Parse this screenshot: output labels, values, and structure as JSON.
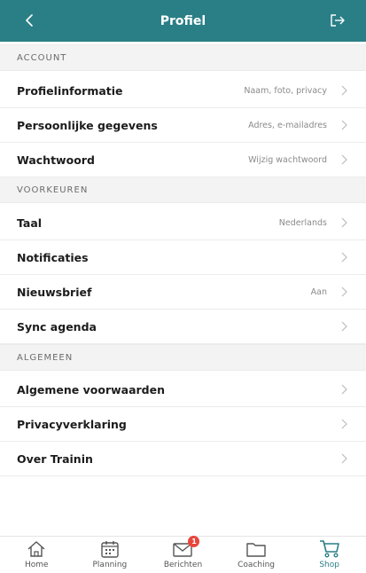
{
  "colors": {
    "accent": "#2a7f86",
    "badge": "#e8463b"
  },
  "header": {
    "title": "Profiel",
    "back_icon": "chevron-left-icon",
    "logout_icon": "logout-icon"
  },
  "sections": [
    {
      "title": "ACCOUNT",
      "items": [
        {
          "label": "Profielinformatie",
          "value": "Naam, foto, privacy"
        },
        {
          "label": "Persoonlijke gegevens",
          "value": "Adres, e-mailadres"
        },
        {
          "label": "Wachtwoord",
          "value": "Wijzig wachtwoord"
        }
      ]
    },
    {
      "title": "VOORKEUREN",
      "items": [
        {
          "label": "Taal",
          "value": "Nederlands"
        },
        {
          "label": "Notificaties",
          "value": ""
        },
        {
          "label": "Nieuwsbrief",
          "value": "Aan"
        },
        {
          "label": "Sync agenda",
          "value": ""
        }
      ]
    },
    {
      "title": "ALGEMEEN",
      "items": [
        {
          "label": "Algemene voorwaarden",
          "value": ""
        },
        {
          "label": "Privacyverklaring",
          "value": ""
        },
        {
          "label": "Over Trainin",
          "value": ""
        }
      ]
    }
  ],
  "tabbar": {
    "items": [
      {
        "label": "Home",
        "icon": "home-icon"
      },
      {
        "label": "Planning",
        "icon": "calendar-icon"
      },
      {
        "label": "Berichten",
        "icon": "mail-icon",
        "badge": "1"
      },
      {
        "label": "Coaching",
        "icon": "folder-icon"
      },
      {
        "label": "Shop",
        "icon": "cart-icon",
        "active": true
      }
    ]
  }
}
